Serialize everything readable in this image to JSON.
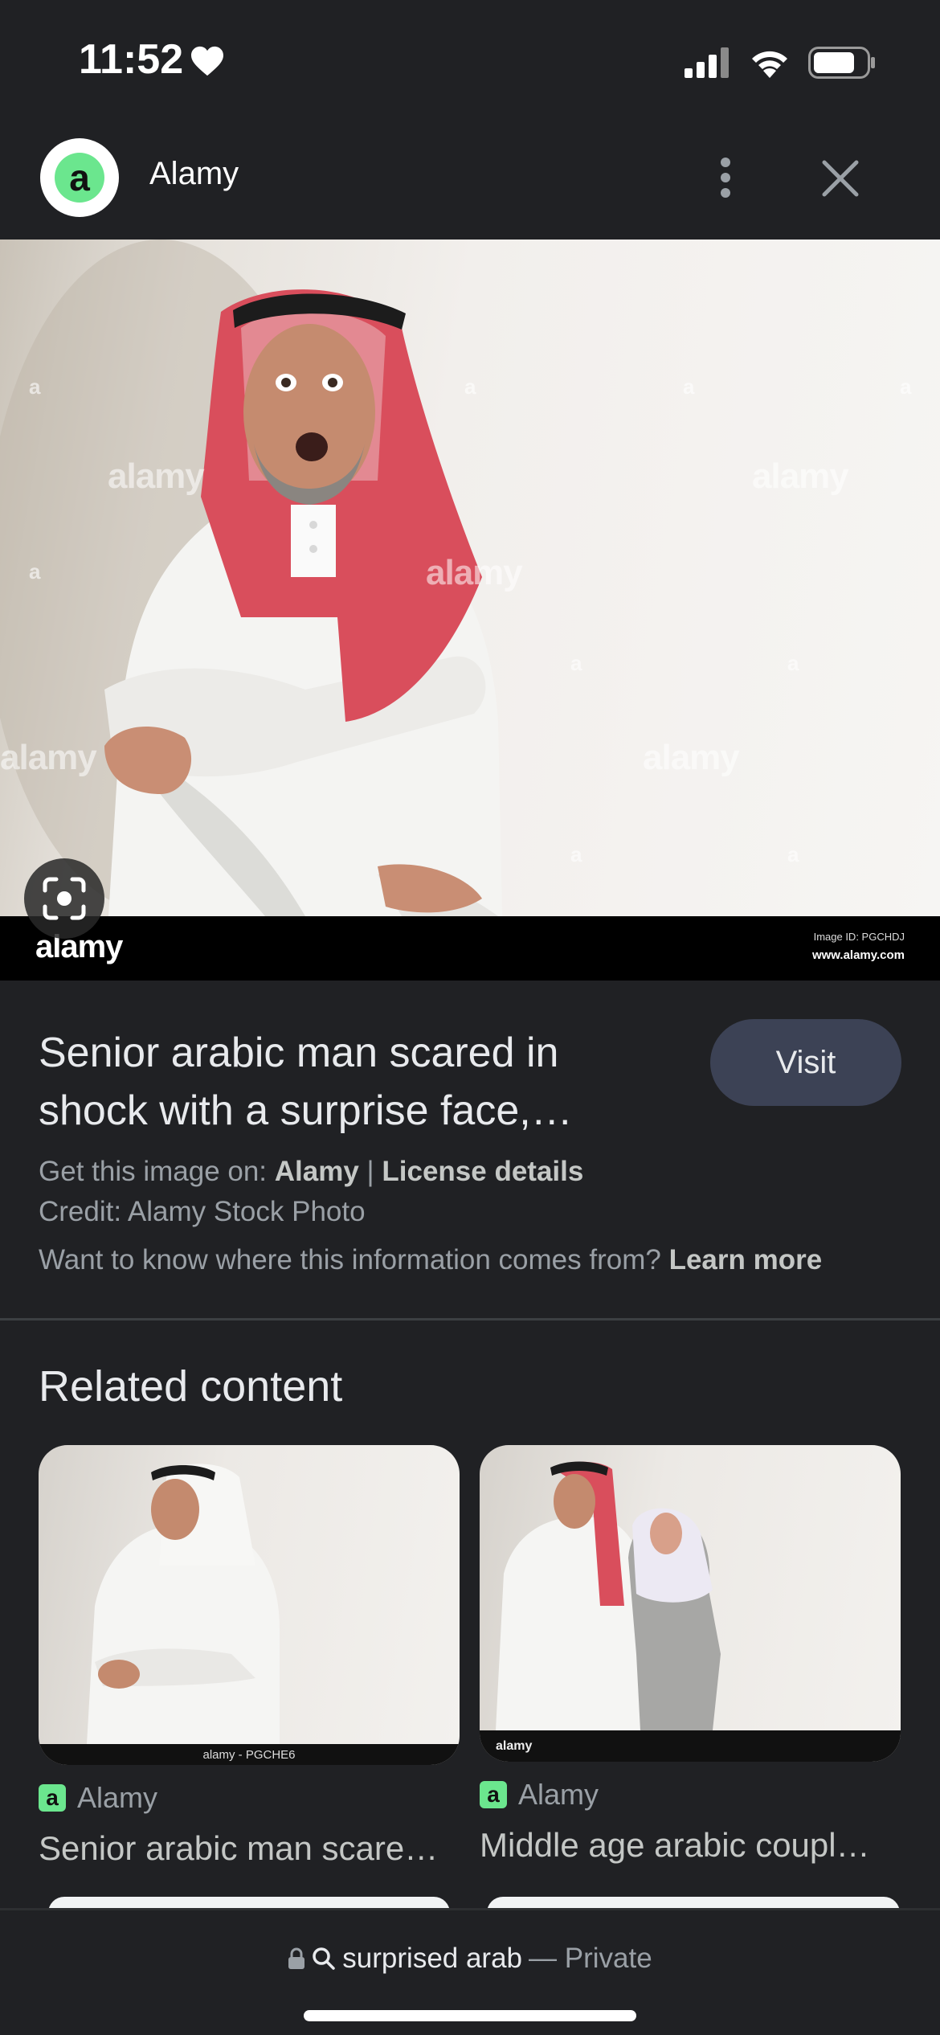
{
  "status_bar": {
    "time": "11:52"
  },
  "header": {
    "site_logo_letter": "a",
    "site_name": "Alamy"
  },
  "hero": {
    "watermark": "alamy",
    "watermark_letter": "a",
    "strip_logo": "alamy",
    "image_id": "Image ID: PGCHDJ",
    "url": "www.alamy.com"
  },
  "info": {
    "title": "Senior arabic man scared in shock with a surprise face,…",
    "visit_label": "Visit",
    "get_label": "Get this image on: ",
    "source": "Alamy",
    "separator": " | ",
    "license_label": "License details",
    "credit": "Credit: Alamy Stock Photo",
    "question": "Want to know where this information comes from? ",
    "learn_more": "Learn more"
  },
  "related": {
    "heading": "Related content",
    "items": [
      {
        "strip_text": "alamy - PGCHE6",
        "source_icon": "a",
        "source": "Alamy",
        "title": "Senior arabic man scare…"
      },
      {
        "strip_text": "alamy",
        "source_icon": "a",
        "source": "Alamy",
        "title": "Middle age arabic coupl…"
      }
    ]
  },
  "bottom_bar": {
    "query": "surprised arab",
    "privacy": "— Private"
  },
  "colors": {
    "background": "#202124",
    "visit_button": "#3c4255",
    "alamy_green": "#6be68e"
  }
}
